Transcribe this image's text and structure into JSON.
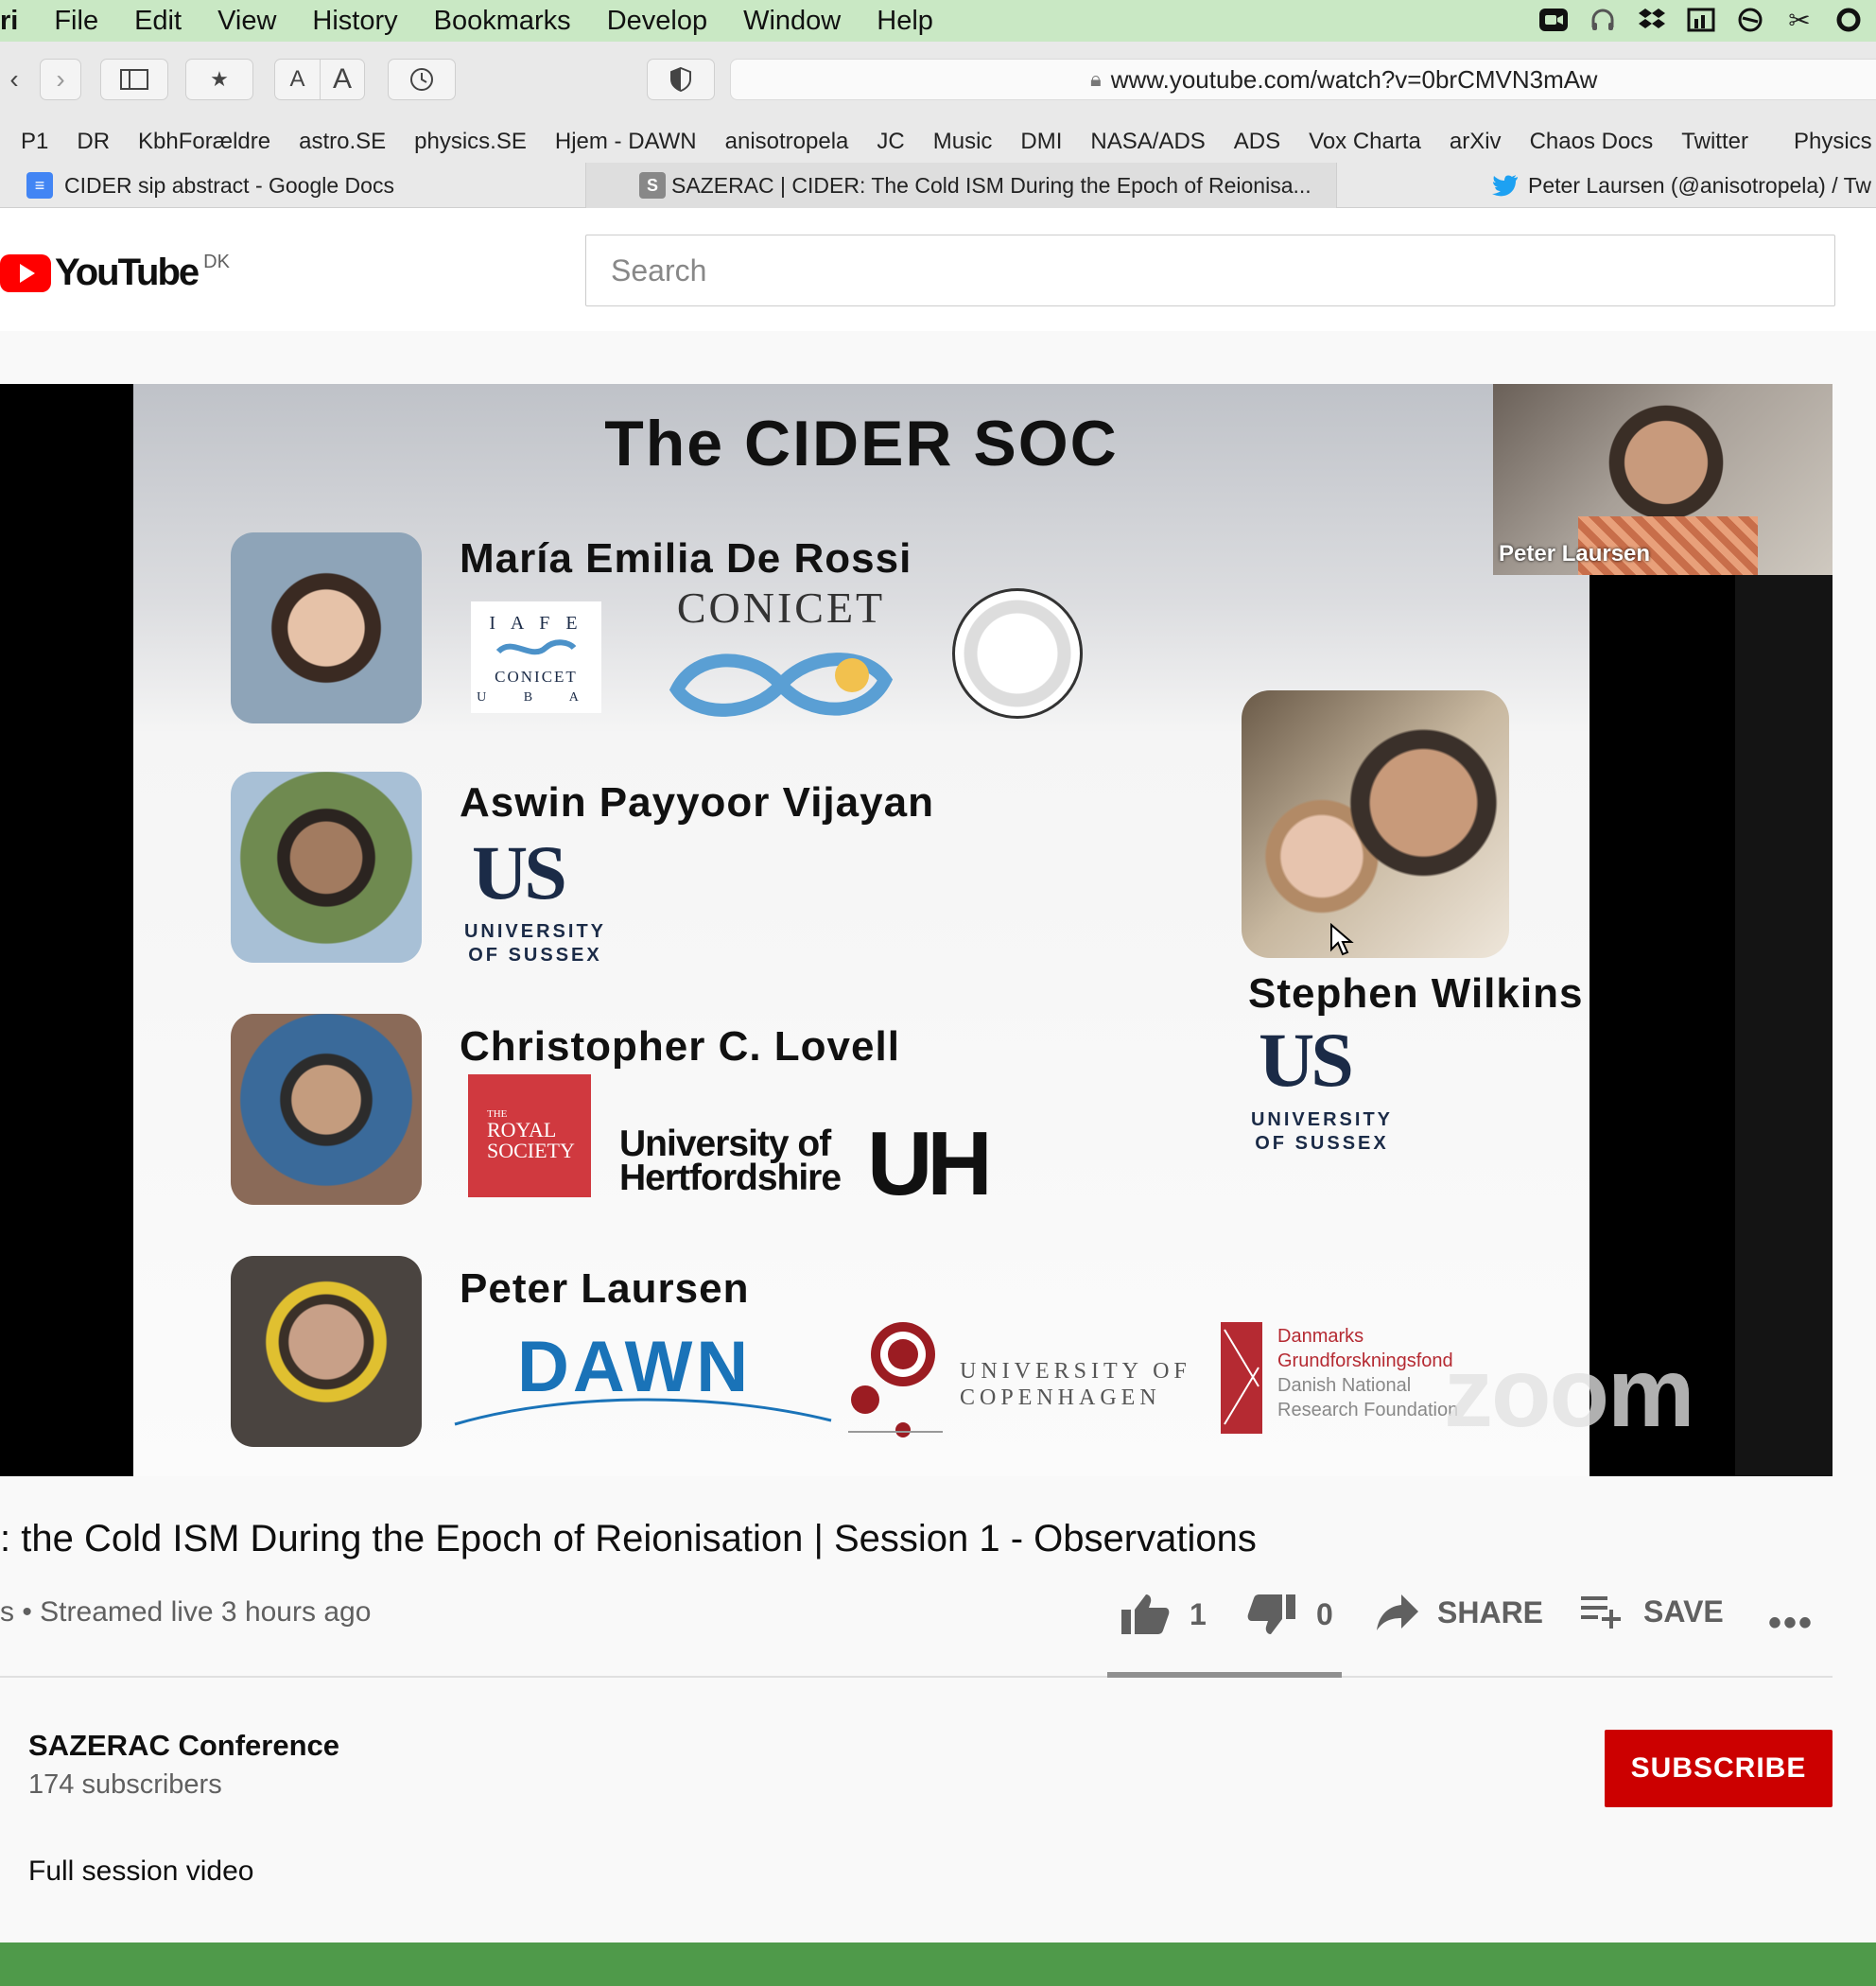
{
  "menubar": {
    "app_fragment": "ri",
    "items": [
      "File",
      "Edit",
      "View",
      "History",
      "Bookmarks",
      "Develop",
      "Window",
      "Help"
    ]
  },
  "toolbar": {
    "url": "www.youtube.com/watch?v=0brCMVN3mAw",
    "text_smaller": "A",
    "text_larger": "A"
  },
  "favorites": [
    "P1",
    "DR",
    "KbhForældre",
    "astro.SE",
    "physics.SE",
    "Hjem - DAWN",
    "anisotropela",
    "JC",
    "Music",
    "DMI",
    "NASA/ADS",
    "ADS",
    "Vox Charta",
    "arXiv",
    "Chaos Docs",
    "Twitter",
    "Physics"
  ],
  "tabs": [
    {
      "title": "CIDER sip abstract - Google Docs",
      "icon": "google-docs-icon",
      "icon_glyph": "≡"
    },
    {
      "title": "SAZERAC | CIDER: The Cold ISM During the Epoch of Reionisa...",
      "icon": "sazerac-icon",
      "icon_glyph": "S"
    },
    {
      "title": "Peter Laursen (@anisotropela) / Tw",
      "icon": "twitter-icon",
      "icon_glyph": ""
    }
  ],
  "youtube": {
    "wordmark": "YouTube",
    "country": "DK",
    "search_placeholder": "Search"
  },
  "slide": {
    "title": "The CIDER SOC",
    "people": [
      {
        "name": "María Emilia De Rossi"
      },
      {
        "name": "Aswin Payyoor Vijayan"
      },
      {
        "name": "Christopher C. Lovell"
      },
      {
        "name": "Peter Laursen"
      },
      {
        "name": "Stephen Wilkins"
      }
    ],
    "logos": {
      "iafe": [
        "I A F E",
        "CONICET",
        "U B A"
      ],
      "conicet": "CONICET",
      "us": "US",
      "us_sub": [
        "UNIVERSITY",
        "OF SUSSEX"
      ],
      "royal_society": [
        "THE",
        "ROYAL",
        "SOCIETY"
      ],
      "herts": [
        "University of",
        "Hertfordshire"
      ],
      "uh": "UH",
      "dawn": "DAWN",
      "ucph": [
        "UNIVERSITY OF",
        "COPENHAGEN"
      ],
      "dnrf": [
        "Danmarks",
        "Grundforskningsfond",
        "Danish National",
        "Research Foundation"
      ]
    },
    "pip_label": "Peter Laursen",
    "watermark": "zoom"
  },
  "video": {
    "title": ": the Cold ISM During the Epoch of Reionisation | Session 1 - Observations",
    "meta": "s • Streamed live 3 hours ago",
    "likes": "1",
    "dislikes": "0",
    "share": "SHARE",
    "save": "SAVE",
    "like_ratio": 1.0
  },
  "channel": {
    "name": "SAZERAC Conference",
    "subscribers": "174 subscribers",
    "subscribe": "SUBSCRIBE"
  },
  "description": "Full session video",
  "colors": {
    "youtube_red": "#ff0000",
    "subscribe_red": "#cc0000",
    "menubar_green": "#c9e8c4",
    "dock_green": "#4f9a4a",
    "sussex_navy": "#1b2b47",
    "royal_red": "#d0393f",
    "dawn_blue": "#1a73b8"
  }
}
